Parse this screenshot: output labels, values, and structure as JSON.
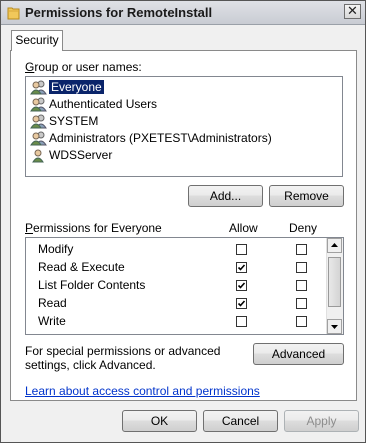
{
  "window": {
    "title": "Permissions for RemoteInstall",
    "close_glyph": "✕"
  },
  "tabs": [
    {
      "label": "Security",
      "active": true
    }
  ],
  "groups": {
    "label": "Group or user names:",
    "items": [
      {
        "label": "Everyone",
        "selected": true,
        "icon": "users-group-icon"
      },
      {
        "label": "Authenticated Users",
        "selected": false,
        "icon": "users-group-icon"
      },
      {
        "label": "SYSTEM",
        "selected": false,
        "icon": "users-group-icon"
      },
      {
        "label": "Administrators (PXETEST\\Administrators)",
        "selected": false,
        "icon": "users-group-icon"
      },
      {
        "label": "WDSServer",
        "selected": false,
        "icon": "user-icon"
      }
    ],
    "add_label": "Add...",
    "remove_label": "Remove"
  },
  "permissions": {
    "label": "Permissions for Everyone",
    "allow_header": "Allow",
    "deny_header": "Deny",
    "rows": [
      {
        "name": "Modify",
        "allow": false,
        "deny": false
      },
      {
        "name": "Read & Execute",
        "allow": true,
        "deny": false
      },
      {
        "name": "List Folder Contents",
        "allow": true,
        "deny": false
      },
      {
        "name": "Read",
        "allow": true,
        "deny": false
      },
      {
        "name": "Write",
        "allow": false,
        "deny": false
      }
    ]
  },
  "advanced": {
    "text": "For special permissions or advanced settings, click Advanced.",
    "button_label": "Advanced"
  },
  "link_text": "Learn about access control and permissions",
  "footer": {
    "ok_label": "OK",
    "cancel_label": "Cancel",
    "apply_label": "Apply",
    "apply_enabled": false
  },
  "colors": {
    "selection": "#0a246a",
    "link": "#0033cc",
    "dialog_bg": "#f0f0f0"
  }
}
